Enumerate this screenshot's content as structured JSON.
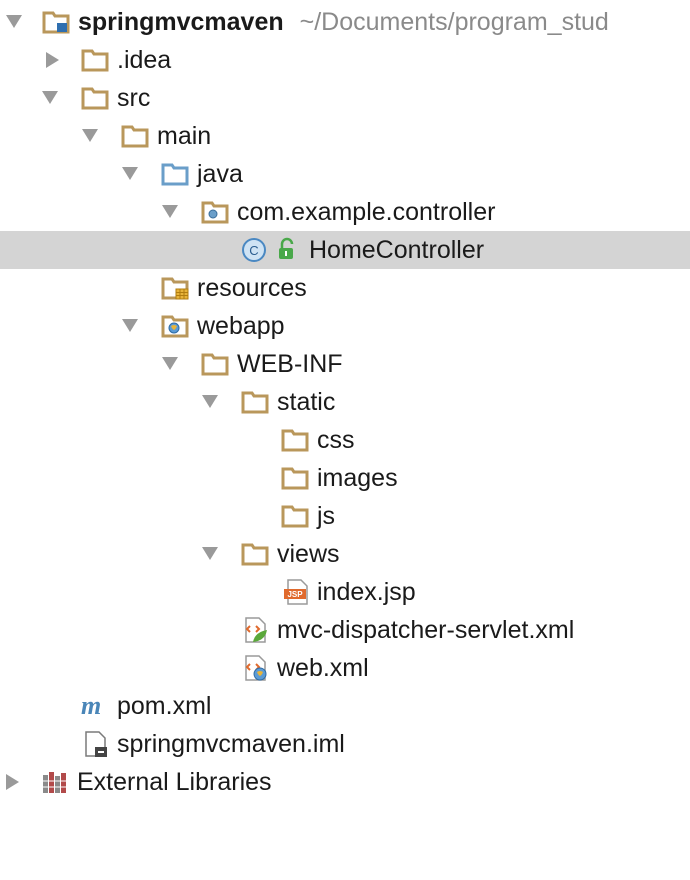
{
  "project": {
    "name": "springmvcmaven",
    "path": "~/Documents/program_stud"
  },
  "tree": {
    "idea": ".idea",
    "src": "src",
    "main": "main",
    "java": "java",
    "package": "com.example.controller",
    "home_controller": "HomeController",
    "resources": "resources",
    "webapp": "webapp",
    "web_inf": "WEB-INF",
    "static": "static",
    "css": "css",
    "images": "images",
    "js": "js",
    "views": "views",
    "index_jsp": "index.jsp",
    "mvc_dispatcher": "mvc-dispatcher-servlet.xml",
    "web_xml": "web.xml",
    "pom": "pom.xml",
    "iml": "springmvcmaven.iml",
    "external_libraries": "External Libraries"
  },
  "icons": {
    "class_badge": "C",
    "jsp_badge": "JSP",
    "maven_badge": "m"
  },
  "colors": {
    "folder": "#b9975b",
    "source_folder": "#6a9ec9",
    "selection": "#d4d4d4",
    "path_text": "#8a8a8a"
  }
}
